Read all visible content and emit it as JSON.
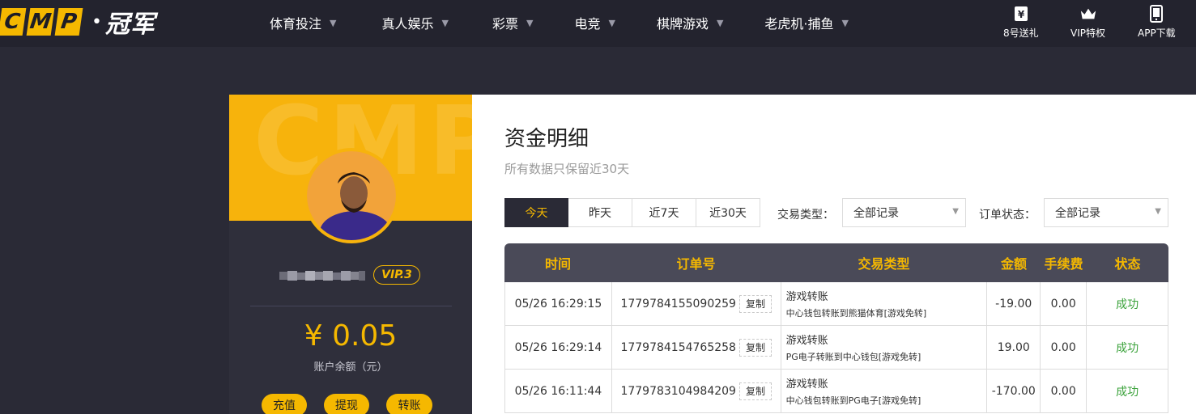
{
  "brand": {
    "letters": [
      "C",
      "M",
      "P"
    ],
    "dot": "•",
    "name": "冠军"
  },
  "nav": [
    {
      "label": "体育投注"
    },
    {
      "label": "真人娱乐"
    },
    {
      "label": "彩票"
    },
    {
      "label": "电竞"
    },
    {
      "label": "棋牌游戏"
    },
    {
      "label": "老虎机·捕鱼"
    }
  ],
  "quick_links": [
    {
      "label": "8号送礼",
      "icon": "gift-yen-icon"
    },
    {
      "label": "VIP特权",
      "icon": "crown-icon"
    },
    {
      "label": "APP下载",
      "icon": "phone-icon"
    }
  ],
  "profile": {
    "watermark": "CMP",
    "vip_level": "VIP.3",
    "balance": "¥ 0.05",
    "balance_label": "账户余额（元）",
    "actions": [
      "充值",
      "提现",
      "转账"
    ]
  },
  "page": {
    "title": "资金明细",
    "subtitle": "所有数据只保留近30天"
  },
  "filters": {
    "date_tabs": [
      "今天",
      "昨天",
      "近7天",
      "近30天"
    ],
    "active_tab": "今天",
    "type_label": "交易类型：",
    "type_value": "全部记录",
    "status_label": "订单状态：",
    "status_value": "全部记录"
  },
  "table": {
    "headers": [
      "时间",
      "订单号",
      "交易类型",
      "金额",
      "手续费",
      "状态"
    ],
    "copy_label": "复制",
    "rows": [
      {
        "time": "05/26 16:29:15",
        "order": "1779784155090259",
        "type": "游戏转账",
        "detail": "中心钱包转账到熊猫体育[游戏免转]",
        "amount": "-19.00",
        "fee": "0.00",
        "status": "成功"
      },
      {
        "time": "05/26 16:29:14",
        "order": "1779784154765258",
        "type": "游戏转账",
        "detail": "PG电子转账到中心钱包[游戏免转]",
        "amount": "19.00",
        "fee": "0.00",
        "status": "成功"
      },
      {
        "time": "05/26 16:11:44",
        "order": "1779783104984209",
        "type": "游戏转账",
        "detail": "中心钱包转账到PG电子[游戏免转]",
        "amount": "-170.00",
        "fee": "0.00",
        "status": "成功"
      }
    ]
  },
  "colors": {
    "accent": "#f5b800",
    "header_bg": "#23232e",
    "body_bg": "#2a2a36",
    "success": "#3aa23a"
  }
}
